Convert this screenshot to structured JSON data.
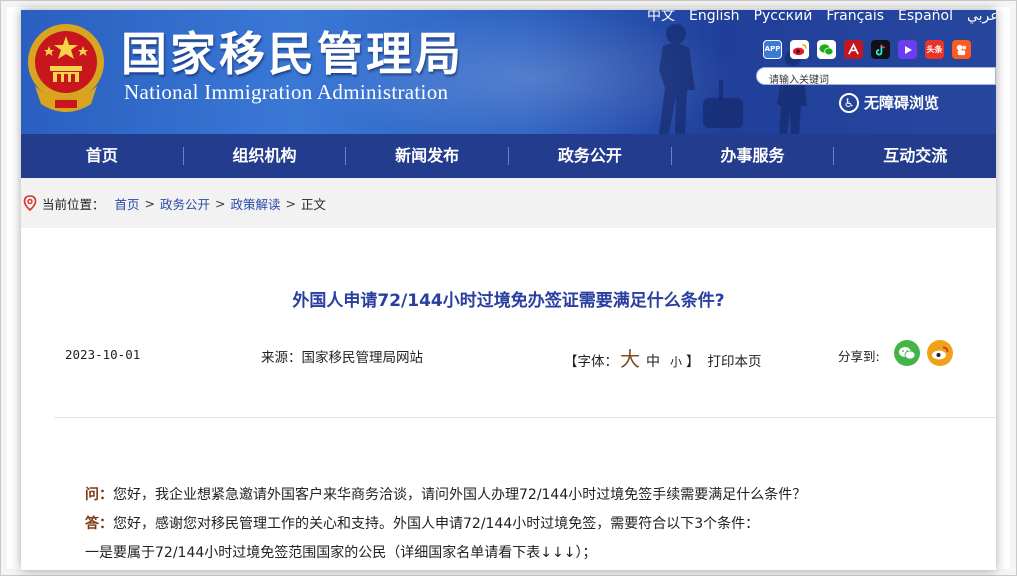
{
  "header": {
    "title_cn": "国家移民管理局",
    "title_en": "National Immigration Administration",
    "languages": [
      "中文",
      "English",
      "Русский",
      "Français",
      "Español",
      "عربي"
    ],
    "search_placeholder": "请输入关键词",
    "accessibility_label": "无障碍浏览",
    "social_icons": [
      "app-icon",
      "weibo-icon",
      "wechat-icon",
      "people-daily-icon",
      "tiktok-icon",
      "video-icon",
      "toutiao-icon",
      "kuaishou-icon"
    ],
    "app_label": "APP",
    "toutiao_label": "头条"
  },
  "nav": {
    "items": [
      "首页",
      "组织机构",
      "新闻发布",
      "政务公开",
      "办事服务",
      "互动交流"
    ]
  },
  "breadcrumb": {
    "prefix": "当前位置：",
    "items": [
      "首页",
      "政务公开",
      "政策解读"
    ],
    "current": "正文",
    "separator": ">"
  },
  "article": {
    "title": "外国人申请72/144小时过境免办签证需要满足什么条件?",
    "date": "2023-10-01",
    "source": "来源：国家移民管理局网站",
    "font_size_prefix": "【字体：",
    "font_size_large": "大",
    "font_size_medium": "中",
    "font_size_small": "小",
    "font_size_suffix": "】",
    "print_label": "打印本页",
    "share_label": "分享到:",
    "question_label": "问：",
    "question_text": "您好，我企业想紧急邀请外国客户来华商务洽谈，请问外国人办理72/144小时过境免签手续需要满足什么条件？",
    "answer_label": "答：",
    "answer_text": "您好，感谢您对移民管理工作的关心和支持。外国人申请72/144小时过境免签，需要符合以下3个条件：",
    "condition_1": "一是要属于72/144小时过境免签范围国家的公民（详细国家名单请看下表↓↓↓）；"
  },
  "colors": {
    "banner": "#2e62c2",
    "nav": "#233c8e",
    "headline": "#2a3ea0",
    "link": "#2b4aa8",
    "qa_label": "#7a3a10"
  }
}
